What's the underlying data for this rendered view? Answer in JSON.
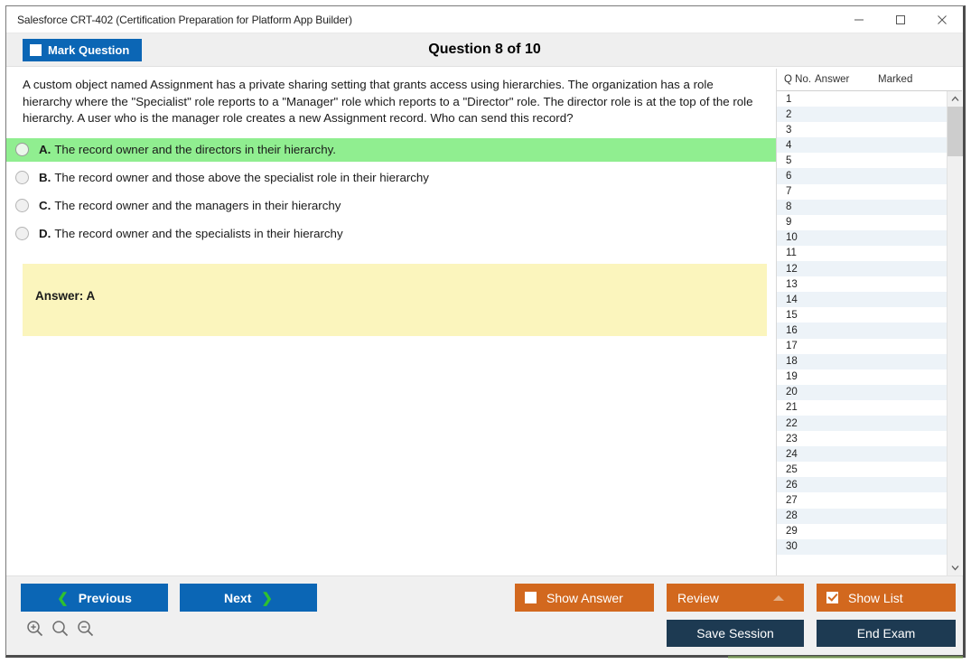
{
  "window": {
    "title": "Salesforce CRT-402 (Certification Preparation for Platform App Builder)",
    "controls": {
      "minimize": "minimize-icon",
      "maximize": "maximize-icon",
      "close": "close-icon"
    }
  },
  "header": {
    "mark_question_label": "Mark Question",
    "mark_question_checked": false,
    "question_counter": "Question 8 of 10"
  },
  "question": {
    "text": "A custom object named Assignment has a private sharing setting that grants access using hierarchies. The organization has a role hierarchy where the \"Specialist\" role reports to a \"Manager\" role which reports to a \"Director\" role. The director role is at the top of the role hierarchy. A user who is the manager role creates a new Assignment record. Who can send this record?",
    "options": [
      {
        "letter": "A.",
        "text": "The record owner and the directors in their hierarchy.",
        "correct": true,
        "selected": false
      },
      {
        "letter": "B.",
        "text": "The record owner and those above the specialist role in their hierarchy",
        "correct": false,
        "selected": false
      },
      {
        "letter": "C.",
        "text": "The record owner and the managers in their hierarchy",
        "correct": false,
        "selected": false
      },
      {
        "letter": "D.",
        "text": "The record owner and the specialists in their hierarchy",
        "correct": false,
        "selected": false
      }
    ],
    "answer_box": "Answer: A"
  },
  "question_list": {
    "columns": [
      "Q No.",
      "Answer",
      "Marked"
    ],
    "rows": [
      {
        "qno": "1",
        "answer": "",
        "marked": ""
      },
      {
        "qno": "2",
        "answer": "",
        "marked": ""
      },
      {
        "qno": "3",
        "answer": "",
        "marked": ""
      },
      {
        "qno": "4",
        "answer": "",
        "marked": ""
      },
      {
        "qno": "5",
        "answer": "",
        "marked": ""
      },
      {
        "qno": "6",
        "answer": "",
        "marked": ""
      },
      {
        "qno": "7",
        "answer": "",
        "marked": ""
      },
      {
        "qno": "8",
        "answer": "",
        "marked": ""
      },
      {
        "qno": "9",
        "answer": "",
        "marked": ""
      },
      {
        "qno": "10",
        "answer": "",
        "marked": ""
      },
      {
        "qno": "11",
        "answer": "",
        "marked": ""
      },
      {
        "qno": "12",
        "answer": "",
        "marked": ""
      },
      {
        "qno": "13",
        "answer": "",
        "marked": ""
      },
      {
        "qno": "14",
        "answer": "",
        "marked": ""
      },
      {
        "qno": "15",
        "answer": "",
        "marked": ""
      },
      {
        "qno": "16",
        "answer": "",
        "marked": ""
      },
      {
        "qno": "17",
        "answer": "",
        "marked": ""
      },
      {
        "qno": "18",
        "answer": "",
        "marked": ""
      },
      {
        "qno": "19",
        "answer": "",
        "marked": ""
      },
      {
        "qno": "20",
        "answer": "",
        "marked": ""
      },
      {
        "qno": "21",
        "answer": "",
        "marked": ""
      },
      {
        "qno": "22",
        "answer": "",
        "marked": ""
      },
      {
        "qno": "23",
        "answer": "",
        "marked": ""
      },
      {
        "qno": "24",
        "answer": "",
        "marked": ""
      },
      {
        "qno": "25",
        "answer": "",
        "marked": ""
      },
      {
        "qno": "26",
        "answer": "",
        "marked": ""
      },
      {
        "qno": "27",
        "answer": "",
        "marked": ""
      },
      {
        "qno": "28",
        "answer": "",
        "marked": ""
      },
      {
        "qno": "29",
        "answer": "",
        "marked": ""
      },
      {
        "qno": "30",
        "answer": "",
        "marked": ""
      }
    ]
  },
  "footer": {
    "previous_label": "Previous",
    "next_label": "Next",
    "show_answer_label": "Show Answer",
    "show_answer_checked": false,
    "review_label": "Review",
    "show_list_label": "Show List",
    "show_list_checked": true,
    "save_session_label": "Save Session",
    "end_exam_label": "End Exam",
    "zoom_icons": [
      "zoom-in-icon",
      "zoom-reset-icon",
      "zoom-out-icon"
    ]
  },
  "colors": {
    "primary_blue": "#0b66b5",
    "orange": "#d2681e",
    "navy": "#1d3a52",
    "correct_green": "#90ee90",
    "answer_yellow": "#fbf5bd",
    "chevron_green": "#2fc12f"
  }
}
